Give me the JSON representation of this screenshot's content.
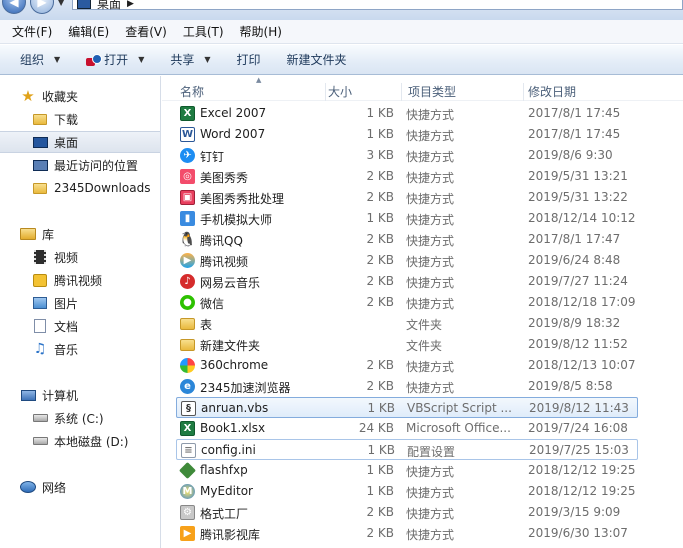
{
  "address": {
    "location": "桌面"
  },
  "menu": [
    "文件(F)",
    "编辑(E)",
    "查看(V)",
    "工具(T)",
    "帮助(H)"
  ],
  "toolbar": {
    "organize": "组织",
    "open": "打开",
    "share": "共享",
    "print": "打印",
    "new_folder": "新建文件夹"
  },
  "nav": {
    "favorites": "收藏夹",
    "downloads": "下载",
    "desktop": "桌面",
    "recent": "最近访问的位置",
    "downloads2345": "2345Downloads",
    "libraries": "库",
    "videos": "视频",
    "tencent_video": "腾讯视频",
    "pictures": "图片",
    "documents": "文档",
    "music": "音乐",
    "computer": "计算机",
    "system_c": "系统 (C:)",
    "local_d": "本地磁盘 (D:)",
    "network": "网络"
  },
  "columns": {
    "name": "名称",
    "size": "大小",
    "type": "项目类型",
    "date": "修改日期"
  },
  "files": [
    {
      "name": "Excel 2007",
      "size": "1 KB",
      "type": "快捷方式",
      "date": "2017/8/1 17:45",
      "icon": "excel-icon"
    },
    {
      "name": "Word 2007",
      "size": "1 KB",
      "type": "快捷方式",
      "date": "2017/8/1 17:45",
      "icon": "word-icon"
    },
    {
      "name": "钉钉",
      "size": "3 KB",
      "type": "快捷方式",
      "date": "2019/8/6 9:30",
      "icon": "dingtalk-icon"
    },
    {
      "name": "美图秀秀",
      "size": "2 KB",
      "type": "快捷方式",
      "date": "2019/5/31 13:21",
      "icon": "meitu-icon"
    },
    {
      "name": "美图秀秀批处理",
      "size": "2 KB",
      "type": "快捷方式",
      "date": "2019/5/31 13:22",
      "icon": "meitu-batch-icon"
    },
    {
      "name": "手机模拟大师",
      "size": "1 KB",
      "type": "快捷方式",
      "date": "2018/12/14 10:12",
      "icon": "phone-emulator-icon"
    },
    {
      "name": "腾讯QQ",
      "size": "2 KB",
      "type": "快捷方式",
      "date": "2017/8/1 17:47",
      "icon": "qq-icon"
    },
    {
      "name": "腾讯视频",
      "size": "2 KB",
      "type": "快捷方式",
      "date": "2019/6/24 8:48",
      "icon": "tencent-video-icon"
    },
    {
      "name": "网易云音乐",
      "size": "2 KB",
      "type": "快捷方式",
      "date": "2019/7/27 11:24",
      "icon": "netease-music-icon"
    },
    {
      "name": "微信",
      "size": "2 KB",
      "type": "快捷方式",
      "date": "2018/12/18 17:09",
      "icon": "wechat-icon"
    },
    {
      "name": "表",
      "size": "",
      "type": "文件夹",
      "date": "2019/8/9 18:32",
      "icon": "folder-icon"
    },
    {
      "name": "新建文件夹",
      "size": "",
      "type": "文件夹",
      "date": "2019/8/12 11:52",
      "icon": "folder-icon"
    },
    {
      "name": "360chrome",
      "size": "2 KB",
      "type": "快捷方式",
      "date": "2018/12/13 10:07",
      "icon": "360chrome-icon"
    },
    {
      "name": "2345加速浏览器",
      "size": "2 KB",
      "type": "快捷方式",
      "date": "2019/8/5 8:58",
      "icon": "browser-2345-icon"
    },
    {
      "name": "anruan.vbs",
      "size": "1 KB",
      "type": "VBScript Script ...",
      "date": "2019/8/12 11:43",
      "icon": "vbs-script-icon"
    },
    {
      "name": "Book1.xlsx",
      "size": "24 KB",
      "type": "Microsoft Office...",
      "date": "2019/7/24 16:08",
      "icon": "xlsx-icon"
    },
    {
      "name": "config.ini",
      "size": "1 KB",
      "type": "配置设置",
      "date": "2019/7/25 15:03",
      "icon": "ini-file-icon"
    },
    {
      "name": "flashfxp",
      "size": "1 KB",
      "type": "快捷方式",
      "date": "2018/12/12 19:25",
      "icon": "flashfxp-icon"
    },
    {
      "name": "MyEditor",
      "size": "1 KB",
      "type": "快捷方式",
      "date": "2018/12/12 19:25",
      "icon": "myeditor-icon"
    },
    {
      "name": "格式工厂",
      "size": "2 KB",
      "type": "快捷方式",
      "date": "2019/3/15 9:09",
      "icon": "format-factory-icon"
    },
    {
      "name": "腾讯影视库",
      "size": "2 KB",
      "type": "快捷方式",
      "date": "2019/6/30 13:07",
      "icon": "tencent-movie-library-icon"
    }
  ]
}
